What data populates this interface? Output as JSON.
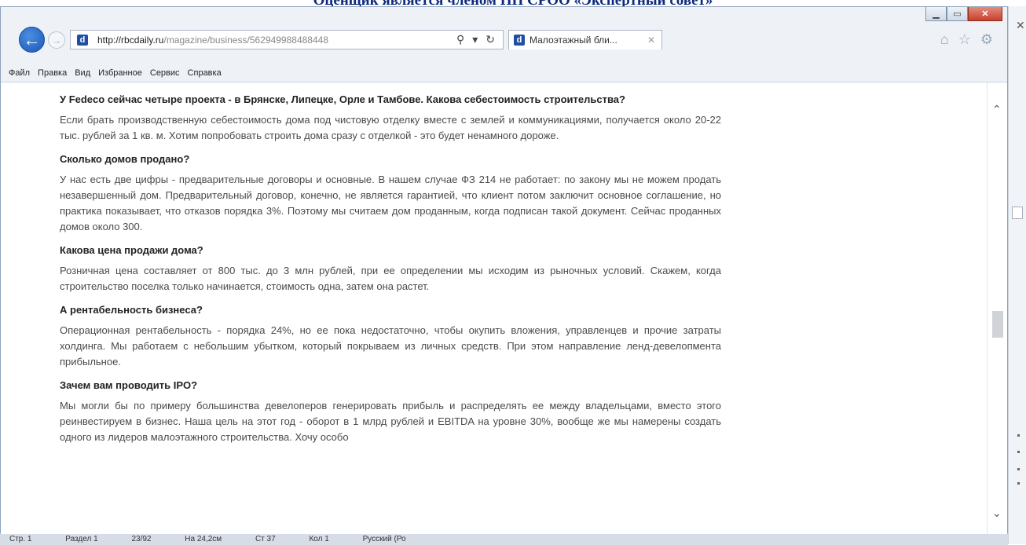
{
  "page": {
    "heading": "Оценщик является членом НП СРОО «Экспертный совет»"
  },
  "browser": {
    "url_host": "http://rbcdaily.ru",
    "url_path": "/magazine/business/562949988488448",
    "tab_title": "Малоэтажный бли...",
    "menu": [
      "Файл",
      "Правка",
      "Вид",
      "Избранное",
      "Сервис",
      "Справка"
    ]
  },
  "article": {
    "clipped_top": "…",
    "blocks": [
      {
        "q": "У Fedeco сейчас четыре проекта - в Брянске, Липецке, Орле и Тамбове. Какова себестоимость строительства?",
        "a": "Если брать производственную себестоимость дома под чистовую отделку вместе с землей и коммуникациями, получается около 20-22 тыс. рублей за 1 кв. м. Хотим попробовать строить дома сразу с отделкой - это будет ненамного дороже."
      },
      {
        "q": "Сколько домов продано?",
        "a": "У нас есть две цифры - предварительные договоры и основные. В нашем случае ФЗ 214 не работает: по закону мы не можем продать незавершенный дом. Предварительный договор, конечно, не является гарантией, что клиент потом заключит основное соглашение, но практика показывает, что отказов порядка 3%. Поэтому мы считаем дом проданным, когда подписан такой документ. Сейчас проданных домов около 300."
      },
      {
        "q": "Какова цена продажи дома?",
        "a": "Розничная цена составляет от 800 тыс. до 3 млн рублей, при ее определении мы исходим из рыночных условий. Скажем, когда строительство поселка только начинается, стоимость одна, затем она растет."
      },
      {
        "q": "А рентабельность бизнеса?",
        "a": "Операционная рентабельность - порядка 24%, но ее пока недостаточно, чтобы окупить вложения, управленцев и прочие затраты холдинга. Мы работаем с небольшим убытком, который покрываем из личных средств. При этом направление ленд-девелопмента прибыльное."
      },
      {
        "q": "Зачем вам проводить IPO?",
        "a": "Мы могли бы по примеру большинства девелоперов генерировать прибыль и распределять ее между владельцами, вместо этого реинвестируем в бизнес. Наша цель на этот год - оборот в 1 млрд рублей и EBITDA на уровне 30%, вообще же мы намерены создать одного из лидеров малоэтажного строительства. Хочу особо"
      }
    ]
  },
  "status_behind": [
    "Стр. 1",
    "Раздел 1",
    "23/92",
    "На 24,2см",
    "Ст 37",
    "Кол 1",
    "Русский (Ро"
  ]
}
